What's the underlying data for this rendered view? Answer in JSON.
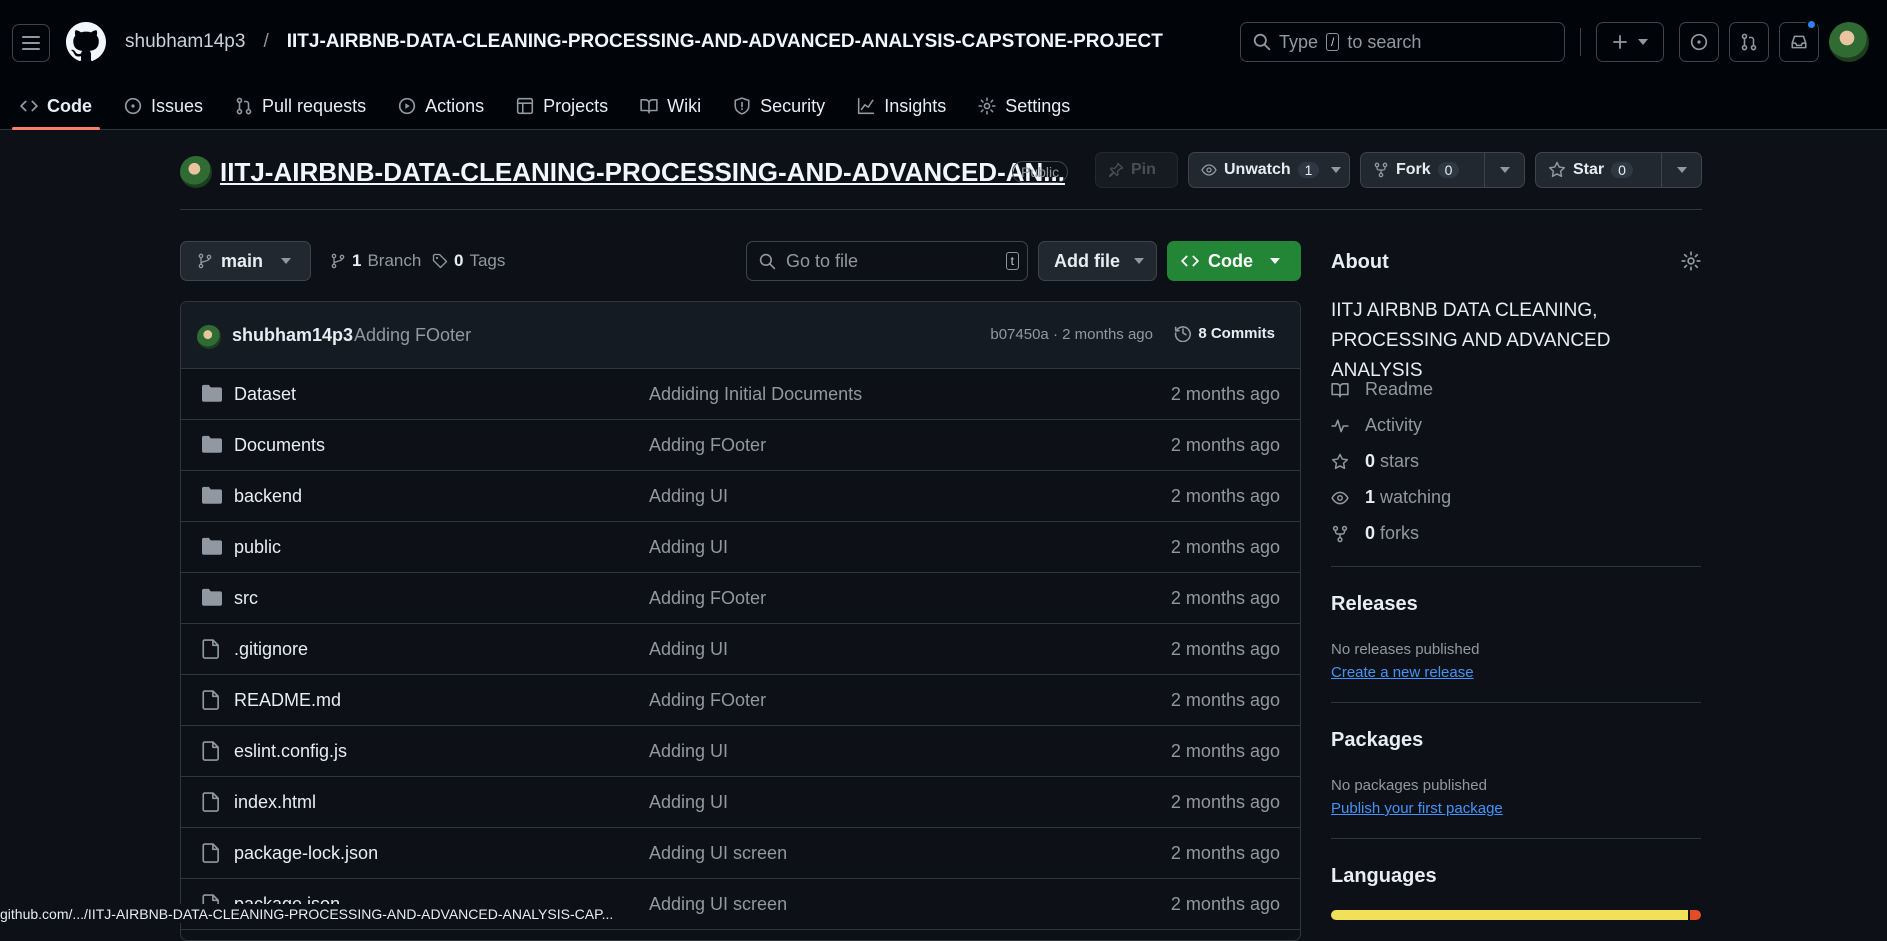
{
  "header": {
    "owner": "shubham14p3",
    "separator": "/",
    "repo": "IITJ-AIRBNB-DATA-CLEANING-PROCESSING-AND-ADVANCED-ANALYSIS-CAPSTONE-PROJECT",
    "search_prefix": "Type",
    "search_key": "/",
    "search_suffix": "to search"
  },
  "tabs": [
    {
      "label": "Code",
      "icon": "code-icon",
      "selected": true
    },
    {
      "label": "Issues",
      "icon": "issue-icon"
    },
    {
      "label": "Pull requests",
      "icon": "pull-request-icon"
    },
    {
      "label": "Actions",
      "icon": "play-icon"
    },
    {
      "label": "Projects",
      "icon": "table-icon"
    },
    {
      "label": "Wiki",
      "icon": "book-icon"
    },
    {
      "label": "Security",
      "icon": "shield-icon"
    },
    {
      "label": "Insights",
      "icon": "graph-icon"
    },
    {
      "label": "Settings",
      "icon": "gear-icon"
    }
  ],
  "repo_header": {
    "title": "IITJ-AIRBNB-DATA-CLEANING-PROCESSING-AND-ADVANCED-AN...",
    "visibility": "Public",
    "pin": "Pin",
    "unwatch": "Unwatch",
    "watch_count": "1",
    "fork": "Fork",
    "fork_count": "0",
    "star": "Star",
    "star_count": "0"
  },
  "toolbar": {
    "branch": "main",
    "branch_count": "1",
    "branch_label": "Branch",
    "tag_count": "0",
    "tag_label": "Tags",
    "goto_placeholder": "Go to file",
    "goto_key": "t",
    "add_file": "Add file",
    "code": "Code"
  },
  "commit": {
    "user": "shubham14p3",
    "message": "Adding FOoter",
    "hash_time": "b07450a · 2 months ago",
    "commits": "8 Commits"
  },
  "files": [
    {
      "name": "Dataset",
      "type": "folder",
      "message": "Addiding Initial Documents",
      "date": "2 months ago"
    },
    {
      "name": "Documents",
      "type": "folder",
      "message": "Adding FOoter",
      "date": "2 months ago"
    },
    {
      "name": "backend",
      "type": "folder",
      "message": "Adding UI",
      "date": "2 months ago"
    },
    {
      "name": "public",
      "type": "folder",
      "message": "Adding UI",
      "date": "2 months ago"
    },
    {
      "name": "src",
      "type": "folder",
      "message": "Adding FOoter",
      "date": "2 months ago"
    },
    {
      "name": ".gitignore",
      "type": "file",
      "message": "Adding UI",
      "date": "2 months ago"
    },
    {
      "name": "README.md",
      "type": "file",
      "message": "Adding FOoter",
      "date": "2 months ago"
    },
    {
      "name": "eslint.config.js",
      "type": "file",
      "message": "Adding UI",
      "date": "2 months ago"
    },
    {
      "name": "index.html",
      "type": "file",
      "message": "Adding UI",
      "date": "2 months ago"
    },
    {
      "name": "package-lock.json",
      "type": "file",
      "message": "Adding UI screen",
      "date": "2 months ago"
    },
    {
      "name": "package.json",
      "type": "file",
      "message": "Adding UI screen",
      "date": "2 months ago"
    }
  ],
  "about": {
    "title": "About",
    "description": "IITJ AIRBNB DATA CLEANING, PROCESSING AND ADVANCED ANALYSIS",
    "readme": "Readme",
    "activity": "Activity",
    "stars_count": "0",
    "stars_label": "stars",
    "watching_count": "1",
    "watching_label": "watching",
    "forks_count": "0",
    "forks_label": "forks"
  },
  "releases": {
    "title": "Releases",
    "none": "No releases published",
    "link": "Create a new release"
  },
  "packages": {
    "title": "Packages",
    "none": "No packages published",
    "link": "Publish your first package"
  },
  "languages": {
    "title": "Languages",
    "colors": [
      "#f1e05a",
      "#e34c26"
    ],
    "shares": [
      0.97,
      0.03
    ]
  },
  "status_url": "github.com/.../IITJ-AIRBNB-DATA-CLEANING-PROCESSING-AND-ADVANCED-ANALYSIS-CAP...",
  "colors": {
    "accent_green": "#238636",
    "tab_underline": "#f78166",
    "link": "#4493f8"
  }
}
